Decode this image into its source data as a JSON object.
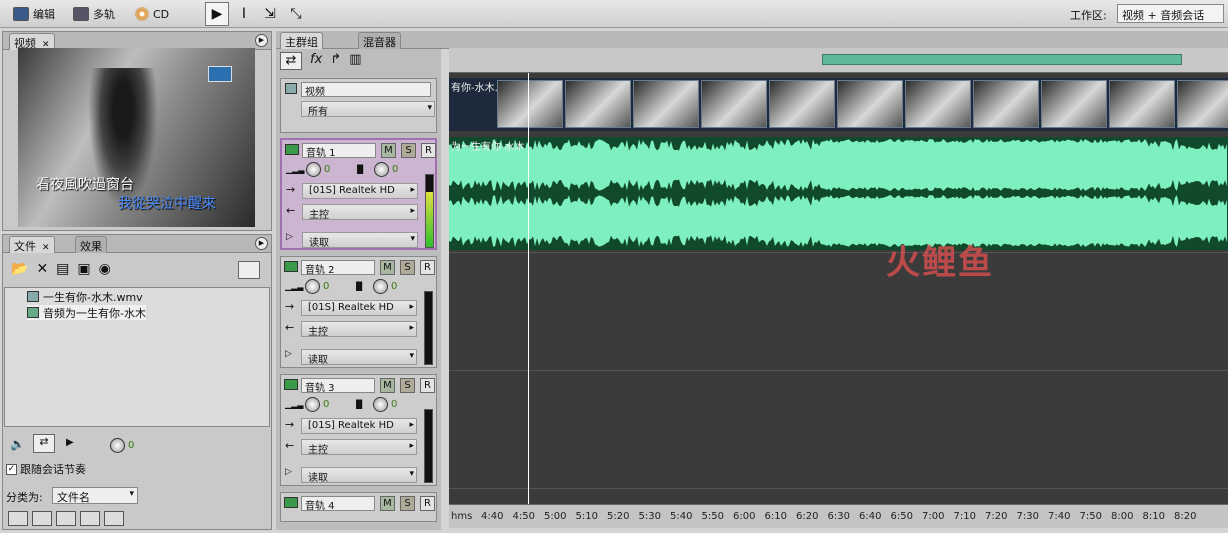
{
  "toolbar": {
    "edit_label": "编辑",
    "multitrack_label": "多轨",
    "cd_label": "CD",
    "workspace_label": "工作区:",
    "workspace_value": "视频 + 音频会话"
  },
  "video_panel": {
    "tab": "视频",
    "subtitle1": "看夜風吹過窗台",
    "subtitle2": "我從哭泣中醒來"
  },
  "files_panel": {
    "tab_files": "文件",
    "tab_effects": "效果",
    "items": [
      "一生有你-水木.wmv",
      "音频为一生有你-水木"
    ],
    "volume_value": "0",
    "follow_session_label": "跟随会话节奏",
    "sort_label": "分类为:",
    "sort_value": "文件名"
  },
  "main_tabs": {
    "main_group": "主群组",
    "mixer": "混音器"
  },
  "video_track": {
    "name": "视频",
    "filter": "所有"
  },
  "tracks": [
    {
      "name": "音轨 1",
      "vol": "0",
      "pan": "0",
      "input": "[01S] Realtek HD",
      "output": "主控",
      "mode": "读取"
    },
    {
      "name": "音轨 2",
      "vol": "0",
      "pan": "0",
      "input": "[01S] Realtek HD",
      "output": "主控",
      "mode": "读取"
    },
    {
      "name": "音轨 3",
      "vol": "0",
      "pan": "0",
      "input": "[01S] Realtek HD",
      "output": "主控",
      "mode": "读取"
    },
    {
      "name": "音轨 4"
    }
  ],
  "msr": {
    "m": "M",
    "s": "S",
    "r": "R"
  },
  "timeline": {
    "video_clip_label": "有你-水木.wmv",
    "audio_clip_label": "为一生有你-水木",
    "watermark": "火鲤鱼",
    "ruler_ticks": [
      "hms",
      "4:40",
      "4:50",
      "5:00",
      "5:10",
      "5:20",
      "5:30",
      "5:40",
      "5:50",
      "6:00",
      "6:10",
      "6:20",
      "6:30",
      "6:40",
      "6:50",
      "7:00",
      "7:10",
      "7:20",
      "7:30",
      "7:40",
      "7:50",
      "8:00",
      "8:10",
      "8:20"
    ]
  },
  "colors": {
    "waveform": "#7ef0c0",
    "waveform_bg": "#114a2a",
    "selected_track": "#a070b0"
  }
}
